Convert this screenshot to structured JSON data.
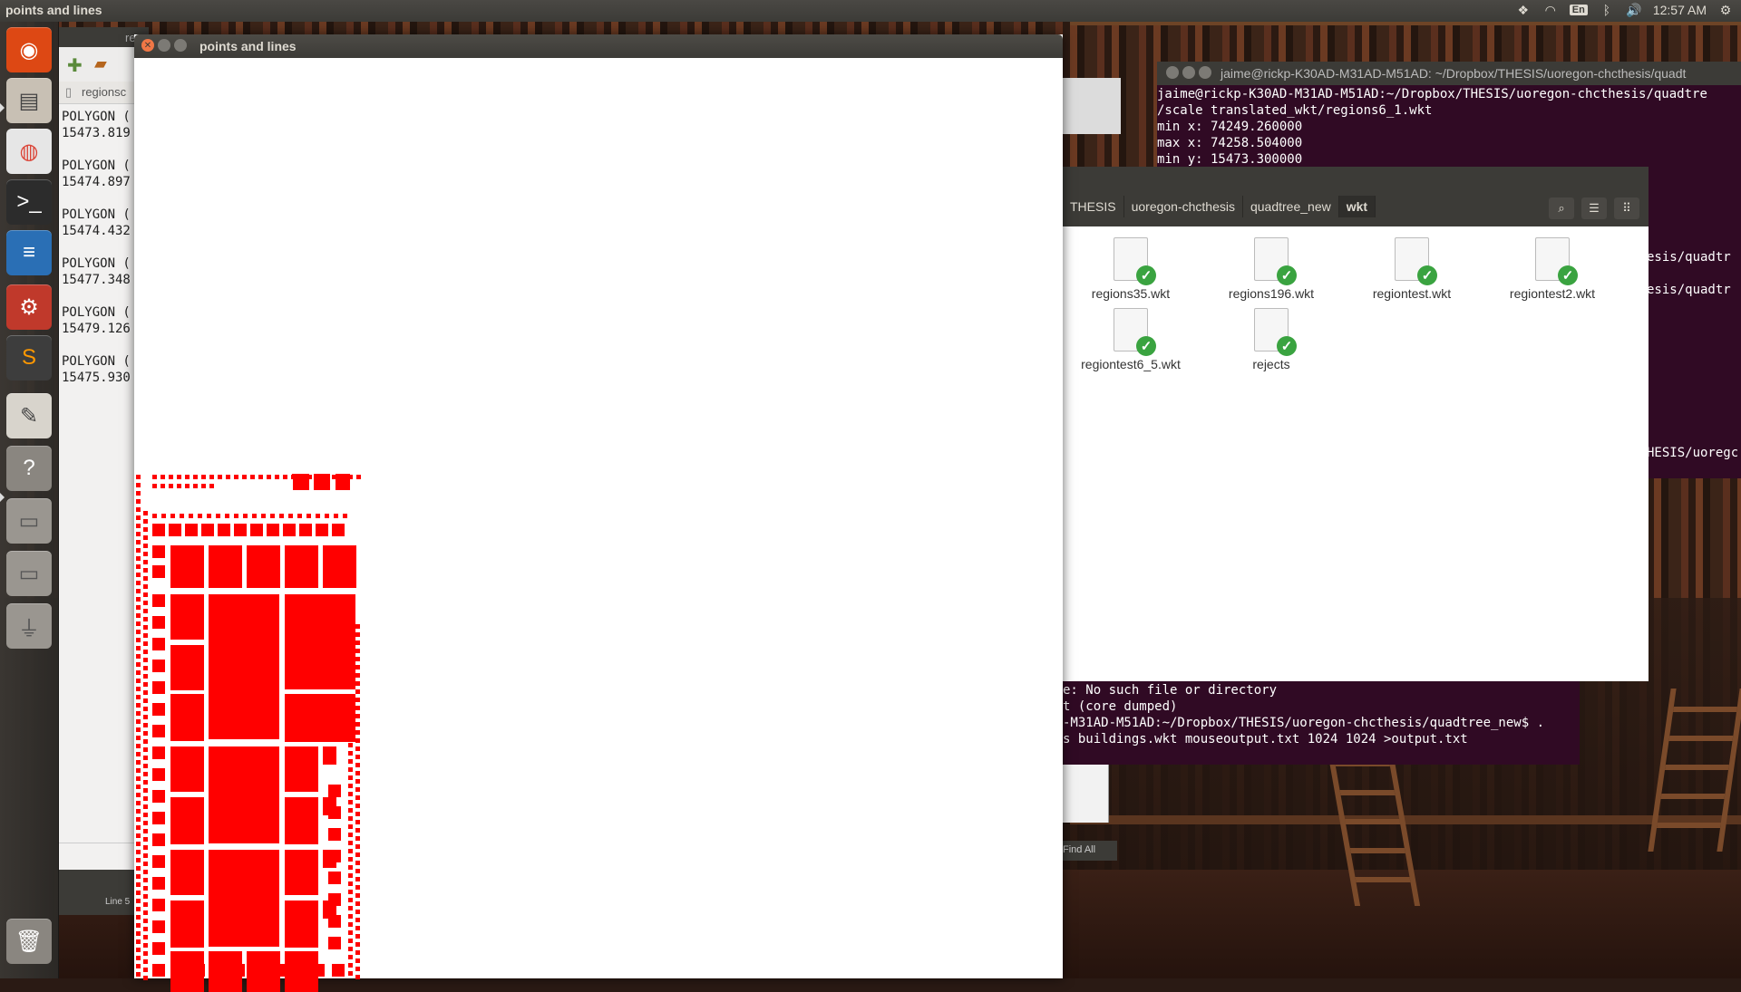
{
  "top_panel": {
    "title": "points and lines",
    "clock": "12:57 AM",
    "lang": "En"
  },
  "launcher": {
    "items": [
      {
        "name": "ubuntu-dash-icon",
        "glyph": "◉"
      },
      {
        "name": "files-icon",
        "glyph": "▤"
      },
      {
        "name": "chrome-icon",
        "glyph": "◍"
      },
      {
        "name": "terminal-icon",
        "glyph": ">_"
      },
      {
        "name": "writer-icon",
        "glyph": "≡"
      },
      {
        "name": "system-settings-icon",
        "glyph": "⚙"
      },
      {
        "name": "sublime-text-icon",
        "glyph": "S"
      },
      {
        "name": "text-editor-icon",
        "glyph": "✎"
      },
      {
        "name": "help-icon",
        "glyph": "?"
      },
      {
        "name": "drive-icon-1",
        "glyph": "▭"
      },
      {
        "name": "drive-icon-2",
        "glyph": "▭"
      },
      {
        "name": "usb-drive-icon",
        "glyph": "⏚"
      },
      {
        "name": "trash-icon",
        "glyph": "🗑"
      }
    ]
  },
  "gedit": {
    "tab_label": "regionsc",
    "title_fragment": "re",
    "text": "POLYGON (\n15473.819\n\nPOLYGON (\n15474.897\n\nPOLYGON (\n15474.432\n\nPOLYGON (\n15477.348\n\nPOLYGON (\n15479.126\n\nPOLYGON (\n15475.930",
    "status": "Line 5"
  },
  "main_window": {
    "title": "points and lines"
  },
  "nautilus": {
    "breadcrumbs": [
      "THESIS",
      "uoregon-chcthesis",
      "quadtree_new",
      "wkt"
    ],
    "files": [
      {
        "name": "regions35.wkt"
      },
      {
        "name": "regions196.wkt"
      },
      {
        "name": "regiontest.wkt"
      },
      {
        "name": "regiontest2.wkt"
      },
      {
        "name": "regiontest6_5.wkt"
      },
      {
        "name": "rejects"
      }
    ]
  },
  "terminal": {
    "title": "jaime@rickp-K30AD-M31AD-M51AD: ~/Dropbox/THESIS/uoregon-chcthesis/quadt",
    "lines": [
      "jaime@rickp-K30AD-M31AD-M51AD:~/Dropbox/THESIS/uoregon-chcthesis/quadtre",
      "/scale translated_wkt/regions6_1.wkt",
      "min x: 74249.260000",
      "max x: 74258.504000",
      "min y: 15473.300000"
    ],
    "right_fragments": [
      "esis/quadtr",
      "esis/quadtr",
      "HESIS/uoregc"
    ],
    "bottom_lines": [
      "e: No such file or directory",
      "t (core dumped)",
      "-M31AD-M51AD:~/Dropbox/THESIS/uoregon-chcthesis/quadtree_new$ .",
      "s buildings.wkt mouseoutput.txt 1024 1024 >output.txt"
    ],
    "find_all": "Find All"
  },
  "colors": {
    "polygon_fill": "#ff0000",
    "panel": "#3c3b37",
    "terminal_bg": "#300a24"
  }
}
